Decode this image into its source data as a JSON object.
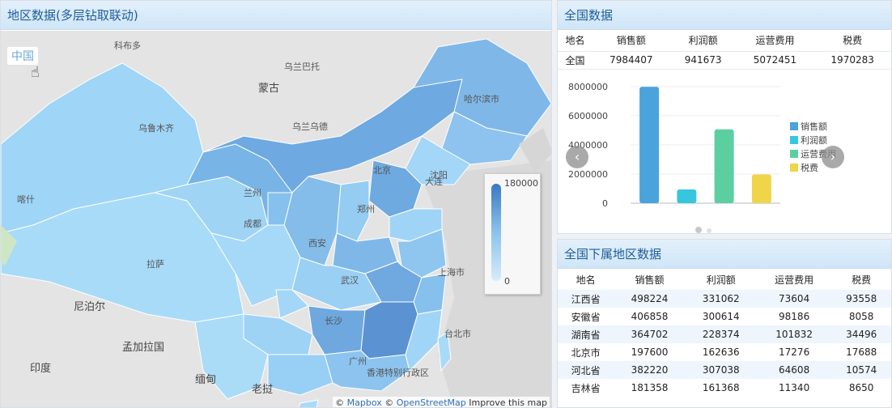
{
  "map_panel": {
    "title": "地区数据(多层钻取联动)",
    "breadcrumb": "中国",
    "legend": {
      "max": "180000",
      "min": "0"
    },
    "attribution": {
      "copy1": "©",
      "mapbox": "Mapbox",
      "copy2": "©",
      "osm": "OpenStreetMap",
      "improve": "Improve this map"
    },
    "labels": {
      "russia_region": "科布多",
      "erdos": "乌兰巴托",
      "mongolia": "蒙古",
      "xinjiang_city": "乌鲁木齐",
      "ulan": "乌兰乌德",
      "shenyang": "沈阳",
      "harbin": "哈尔滨市",
      "beijing_lbl": "北京",
      "dalian": "大连",
      "shanghai": "上海市",
      "taipei": "台北市",
      "hongkong": "香港特别行政区",
      "india": "印度",
      "nepal": "尼泊尔",
      "bangladesh": "孟加拉国",
      "myanmar": "缅甸",
      "laos": "老挝",
      "kashi": "喀什",
      "lasa": "拉萨",
      "chengdu": "成都",
      "xian": "西安",
      "lanzhou": "兰州",
      "zhengzhou": "郑州",
      "wuhan": "武汉",
      "changsha": "长沙",
      "guangzhou": "广州"
    }
  },
  "national": {
    "title": "全国数据",
    "headers": [
      "地名",
      "销售额",
      "利润额",
      "运营费用",
      "税费"
    ],
    "row": [
      "全国",
      "7984407",
      "941673",
      "5072451",
      "1970283"
    ]
  },
  "chart_data": {
    "type": "bar",
    "categories": [
      "销售额",
      "利润额",
      "运营费用",
      "税费"
    ],
    "values": [
      7984407,
      941673,
      5072451,
      1970283
    ],
    "colors": [
      "#4aa3db",
      "#38c6df",
      "#5ccfa0",
      "#f0d44a"
    ],
    "ylim": [
      0,
      8000000
    ],
    "yticks": [
      "8000000",
      "6000000",
      "4000000",
      "2000000",
      "0"
    ],
    "legend": [
      "销售额",
      "利润额",
      "运营费用",
      "税费"
    ],
    "legend_position": "right"
  },
  "subregion": {
    "title": "全国下属地区数据",
    "headers": [
      "地名",
      "销售额",
      "利润额",
      "运营费用",
      "税费"
    ],
    "rows": [
      [
        "江西省",
        "498224",
        "331062",
        "73604",
        "93558"
      ],
      [
        "安徽省",
        "406858",
        "300614",
        "98186",
        "8058"
      ],
      [
        "湖南省",
        "364702",
        "228374",
        "101832",
        "34496"
      ],
      [
        "北京市",
        "197600",
        "162636",
        "17276",
        "17688"
      ],
      [
        "河北省",
        "382220",
        "307038",
        "64608",
        "10574"
      ],
      [
        "吉林省",
        "181358",
        "161368",
        "11340",
        "8650"
      ]
    ]
  }
}
